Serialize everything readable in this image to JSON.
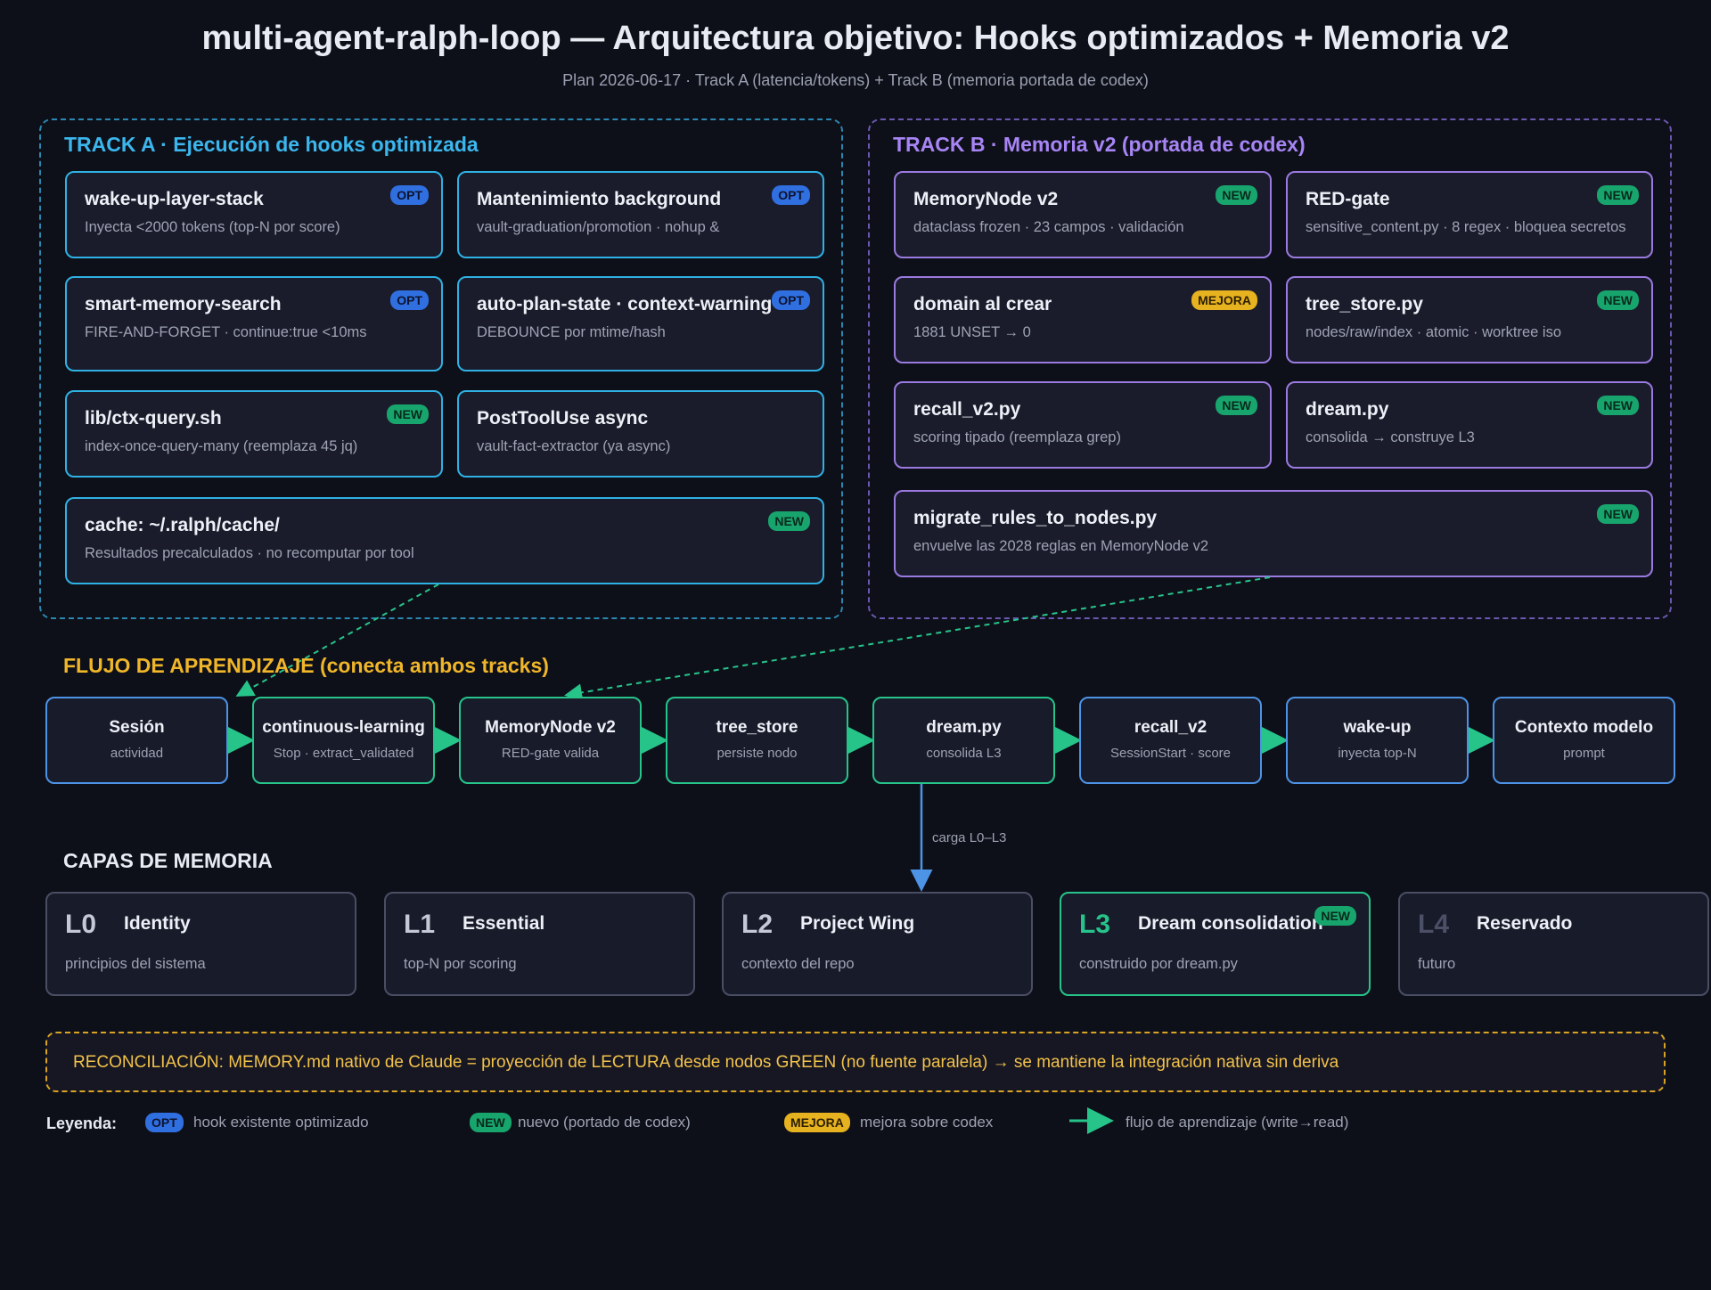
{
  "header": {
    "title": "multi-agent-ralph-loop — Arquitectura objetivo: Hooks optimizados + Memoria v2",
    "subtitle": "Plan 2026-06-17 · Track A (latencia/tokens) + Track B (memoria portada de codex)"
  },
  "track_a": {
    "title": "TRACK A · Ejecución de hooks optimizada",
    "cards": [
      {
        "name": "wake-up-layer-stack",
        "desc": "Inyecta <2000 tokens (top-N por score)",
        "badge": "OPT"
      },
      {
        "name": "Mantenimiento background",
        "desc": "vault-graduation/promotion · nohup &",
        "badge": "OPT"
      },
      {
        "name": "smart-memory-search",
        "desc": "FIRE-AND-FORGET · continue:true <10ms",
        "badge": "OPT"
      },
      {
        "name": "auto-plan-state · context-warning",
        "desc": "DEBOUNCE por mtime/hash",
        "badge": "OPT"
      },
      {
        "name": "lib/ctx-query.sh",
        "desc": "index-once-query-many (reemplaza 45 jq)",
        "badge": "NEW"
      },
      {
        "name": "PostToolUse async",
        "desc": "vault-fact-extractor (ya async)",
        "badge": ""
      },
      {
        "name": "cache: ~/.ralph/cache/",
        "desc": "Resultados precalculados · no recomputar por tool",
        "badge": "NEW"
      }
    ]
  },
  "track_b": {
    "title": "TRACK B · Memoria v2 (portada de codex)",
    "cards": [
      {
        "name": "MemoryNode v2",
        "desc": "dataclass frozen · 23 campos · validación",
        "badge": "NEW"
      },
      {
        "name": "RED-gate",
        "desc": "sensitive_content.py · 8 regex · bloquea secretos",
        "badge": "NEW"
      },
      {
        "name": "domain al crear",
        "desc": "1881 UNSET → 0",
        "badge": "MEJORA"
      },
      {
        "name": "tree_store.py",
        "desc": "nodes/raw/index · atomic · worktree iso",
        "badge": "NEW"
      },
      {
        "name": "recall_v2.py",
        "desc": "scoring tipado (reemplaza grep)",
        "badge": "NEW"
      },
      {
        "name": "dream.py",
        "desc": "consolida → construye L3",
        "badge": "NEW"
      },
      {
        "name": "migrate_rules_to_nodes.py",
        "desc": "envuelve las 2028 reglas en MemoryNode v2",
        "badge": "NEW"
      }
    ]
  },
  "flow": {
    "title": "FLUJO DE APRENDIZAJE (conecta ambos tracks)",
    "nodes": [
      {
        "name": "Sesión",
        "sub": "actividad",
        "kind": "blue"
      },
      {
        "name": "continuous-learning",
        "sub": "Stop · extract_validated",
        "kind": "green"
      },
      {
        "name": "MemoryNode v2",
        "sub": "RED-gate valida",
        "kind": "green"
      },
      {
        "name": "tree_store",
        "sub": "persiste nodo",
        "kind": "green"
      },
      {
        "name": "dream.py",
        "sub": "consolida L3",
        "kind": "green"
      },
      {
        "name": "recall_v2",
        "sub": "SessionStart · score",
        "kind": "blue"
      },
      {
        "name": "wake-up",
        "sub": "inyecta top-N",
        "kind": "blue"
      },
      {
        "name": "Contexto modelo",
        "sub": "prompt",
        "kind": "blue"
      }
    ],
    "load_label": "carga L0–L3"
  },
  "layers": {
    "title": "CAPAS DE MEMORIA",
    "items": [
      {
        "code": "L0",
        "name": "Identity",
        "desc": "principios del sistema",
        "badge": ""
      },
      {
        "code": "L1",
        "name": "Essential",
        "desc": "top-N por scoring",
        "badge": ""
      },
      {
        "code": "L2",
        "name": "Project Wing",
        "desc": "contexto del repo",
        "badge": ""
      },
      {
        "code": "L3",
        "name": "Dream consolidation",
        "desc": "construido por dream.py",
        "badge": "NEW"
      },
      {
        "code": "L4",
        "name": "Reservado",
        "desc": "futuro",
        "badge": ""
      }
    ]
  },
  "reconciliation": "RECONCILIACIÓN: MEMORY.md nativo de Claude = proyección de LECTURA desde nodos GREEN (no fuente paralela) → se mantiene la integración nativa sin deriva",
  "legend": {
    "label": "Leyenda:",
    "items": [
      {
        "badge": "OPT",
        "text": "hook existente optimizado"
      },
      {
        "badge": "NEW",
        "text": "nuevo (portado de codex)"
      },
      {
        "badge": "MEJORA",
        "text": "mejora sobre codex"
      },
      {
        "badge": "",
        "text": "flujo de aprendizaje (write→read)"
      }
    ]
  },
  "colors": {
    "background": "#0e1019",
    "track_a": "#3bb7ee",
    "track_b": "#a785f5",
    "flow_green": "#27c48a",
    "flow_blue": "#4d93e6",
    "opt_badge": "#2f6fe0",
    "new_badge": "#18a56d",
    "mejora_badge": "#e7b21f",
    "reconciliation": "#f2c34a"
  }
}
